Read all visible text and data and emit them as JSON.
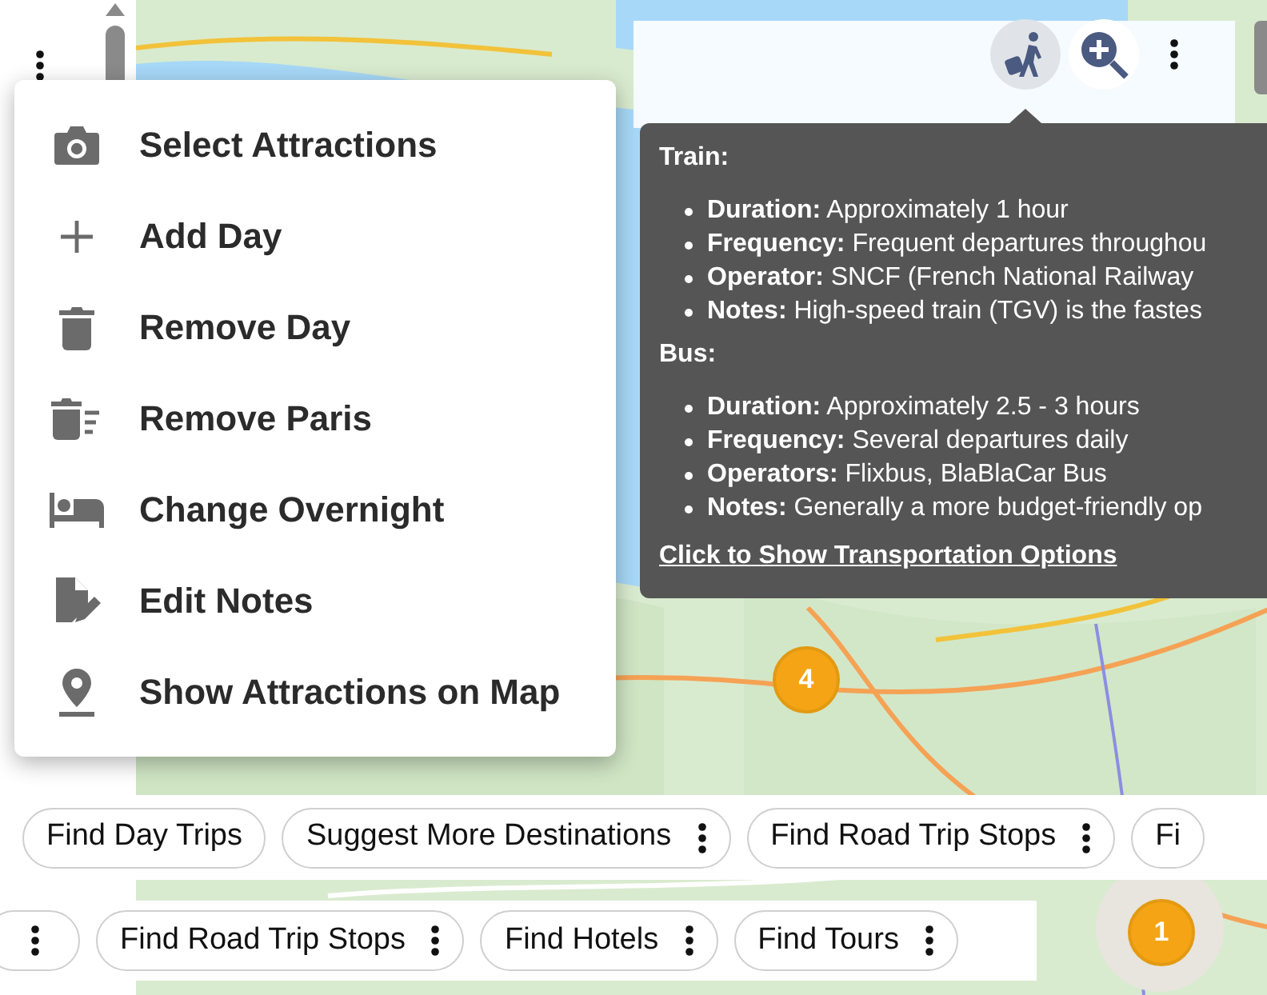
{
  "context_menu": {
    "items": [
      {
        "label": "Select Attractions"
      },
      {
        "label": "Add Day"
      },
      {
        "label": "Remove Day"
      },
      {
        "label": "Remove Paris"
      },
      {
        "label": "Change Overnight"
      },
      {
        "label": "Edit Notes"
      },
      {
        "label": "Show Attractions on Map"
      }
    ]
  },
  "map": {
    "markers": [
      {
        "label": "4"
      },
      {
        "label": "1"
      }
    ]
  },
  "toolbar": {
    "buttons": [
      {
        "selected": true
      },
      {
        "selected": false
      }
    ]
  },
  "tooltip": {
    "sections": [
      {
        "title": "Train:",
        "items": [
          "**Duration:** Approximately 1 hour",
          "**Frequency:** Frequent departures throughou",
          "**Operator:** SNCF (French National Railway",
          "**Notes:** High-speed train (TGV) is the fastes"
        ]
      },
      {
        "title": "Bus:",
        "items": [
          "**Duration:** Approximately 2.5 - 3 hours",
          "**Frequency:** Several departures daily",
          "**Operators:** Flixbus, BlaBlaCar Bus",
          "**Notes:** Generally a more budget-friendly op"
        ]
      }
    ],
    "link": "Click to Show Transportation Options"
  },
  "chip_rows": [
    [
      {
        "label": "Find Day Trips",
        "has_menu": false
      },
      {
        "label": "Suggest More Destinations",
        "has_menu": true
      },
      {
        "label": "Find Road Trip Stops",
        "has_menu": true
      },
      {
        "label": "Fi",
        "has_menu": false
      }
    ],
    [
      {
        "has_menu": true
      },
      {
        "label": "Find Road Trip Stops",
        "has_menu": true
      },
      {
        "label": "Find Hotels",
        "has_menu": true
      },
      {
        "label": "Find Tours",
        "has_menu": true
      }
    ]
  ]
}
